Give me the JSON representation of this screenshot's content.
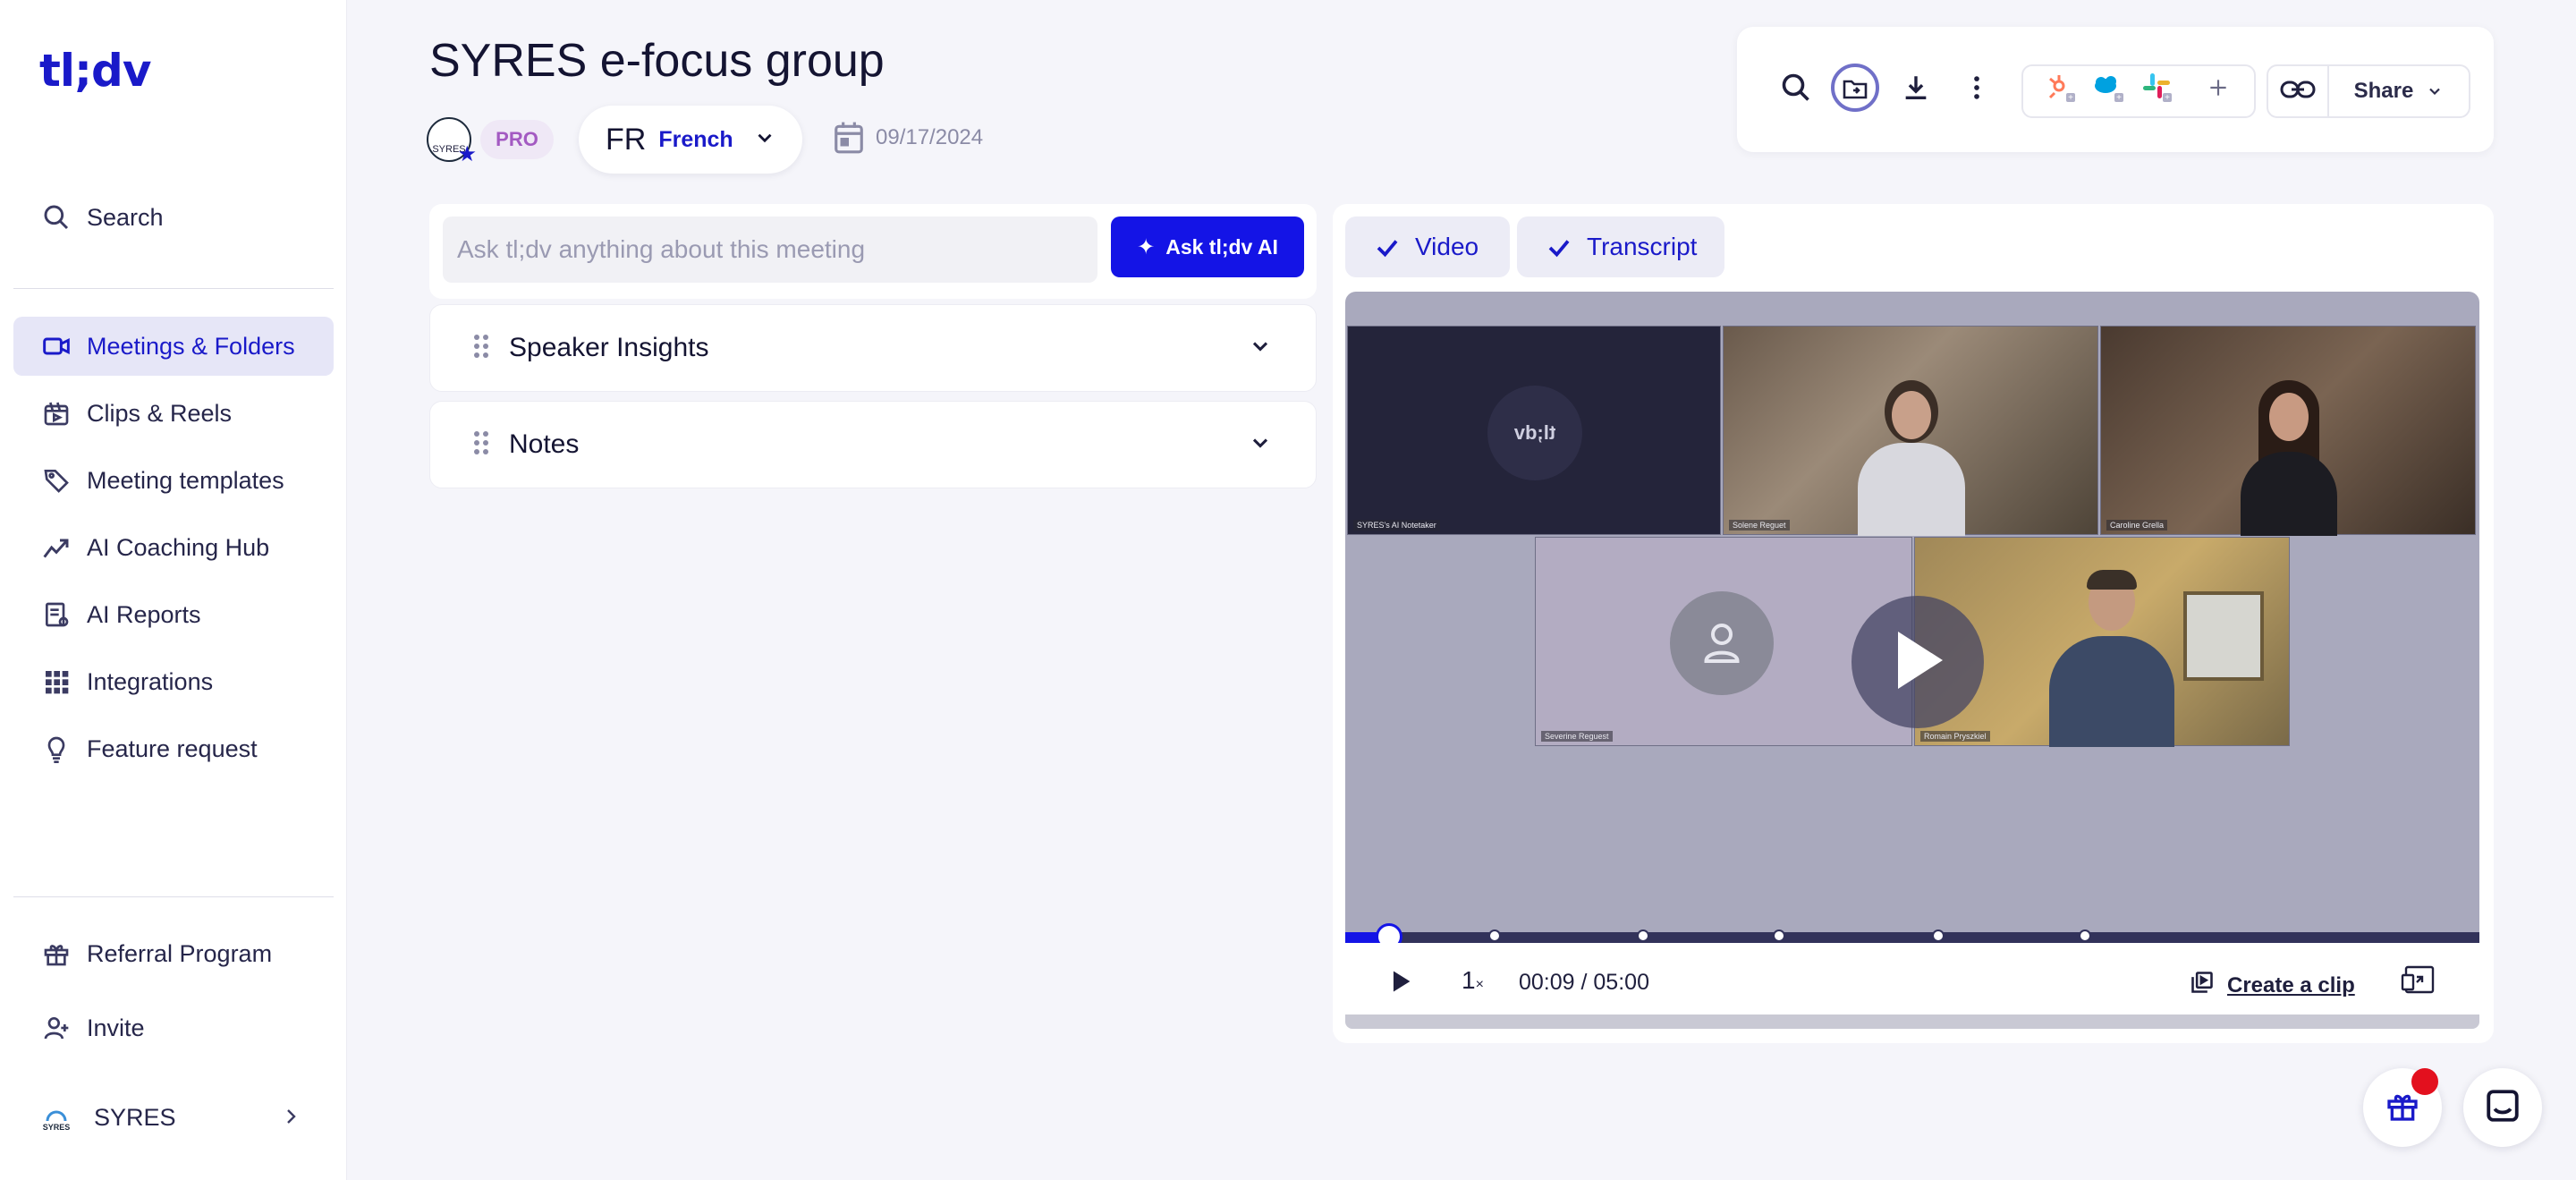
{
  "app": {
    "logo": "tl;dv"
  },
  "sidebar": {
    "search_label": "Search",
    "items": [
      {
        "label": "Meetings & Folders",
        "icon": "video-camera-icon",
        "active": true
      },
      {
        "label": "Clips & Reels",
        "icon": "film-icon"
      },
      {
        "label": "Meeting templates",
        "icon": "tag-icon"
      },
      {
        "label": "AI Coaching Hub",
        "icon": "trend-chart-icon"
      },
      {
        "label": "AI Reports",
        "icon": "report-icon"
      },
      {
        "label": "Integrations",
        "icon": "grid-icon"
      },
      {
        "label": "Feature request",
        "icon": "lightbulb-icon"
      }
    ],
    "bottom": [
      {
        "label": "Referral Program",
        "icon": "gift-icon"
      },
      {
        "label": "Invite",
        "icon": "add-person-icon"
      }
    ],
    "workspace": {
      "name": "SYRES",
      "logo_text": "SYRES"
    }
  },
  "meeting": {
    "title": "SYRES e-focus group",
    "plan_badge": "PRO",
    "language": {
      "code": "FR",
      "name": "French"
    },
    "date": "09/17/2024"
  },
  "toolbar": {
    "share_label": "Share"
  },
  "ask": {
    "placeholder": "Ask tl;dv anything about this meeting",
    "button_label": "Ask tl;dv AI"
  },
  "sections": [
    {
      "label": "Speaker Insights"
    },
    {
      "label": "Notes"
    }
  ],
  "player": {
    "tabs": [
      {
        "label": "Video"
      },
      {
        "label": "Transcript"
      }
    ],
    "participants": [
      "SYRES's AI Notetaker",
      "Solene Reguet",
      "Caroline Grella",
      "Severine Reguest",
      "Romain Pryszkiel"
    ],
    "bot_tile_text": "tl;dv",
    "speed": "1",
    "speed_suffix": "×",
    "current_time": "00:09",
    "duration": "05:00",
    "time_separator": " / ",
    "progress": 0.03,
    "create_clip_label": "Create a clip"
  },
  "colors": {
    "brand": "#1414e6",
    "accent_purple": "#a35ac2",
    "notification": "#e3101e"
  }
}
